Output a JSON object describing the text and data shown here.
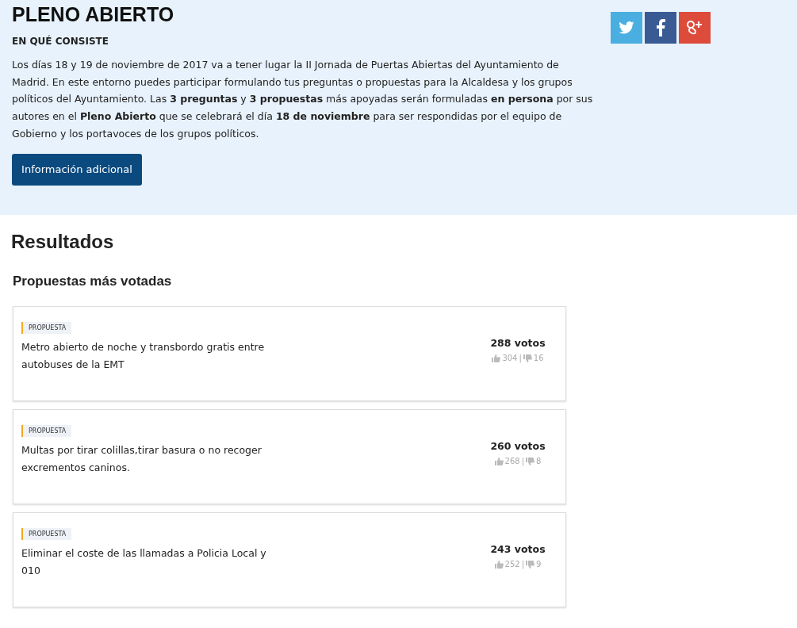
{
  "header": {
    "title": "PLENO ABIERTO",
    "subtitle": "EN QUÉ CONSISTE",
    "description": "Los días 18 y 19 de noviembre de 2017 va a tener lugar la II Jornada de Puertas Abiertas del Ayuntamiento de Madrid. En este entorno puedes participar formulando tus preguntas o propuestas para la Alcaldesa y los grupos políticos del Ayuntamiento. Las **3 preguntas** y **3 propuestas** más apoyadas serán formuladas **en persona** por sus autores en el **Pleno Abierto** que se celebrará el día **18 de noviembre** para ser respondidas por el equipo de Gobierno y los portavoces de los grupos políticos.",
    "button": "Información adicional",
    "social": [
      {
        "kind": "twitter",
        "color": "#4aafe0"
      },
      {
        "kind": "facebook",
        "color": "#3a5a94"
      },
      {
        "kind": "googleplus",
        "color": "#dd4b3b"
      }
    ]
  },
  "results": {
    "title": "Resultados",
    "section": "Propuestas más votadas",
    "proposals": [
      {
        "tag": "PROPUESTA",
        "title": "Metro abierto de noche y transbordo gratis entre autobuses de la EMT",
        "votes": "288 votos",
        "likes": "304",
        "separator": "|",
        "dislikes": "16"
      },
      {
        "tag": "PROPUESTA",
        "title": "Multas por tirar colillas,tirar basura o no recoger excrementos caninos.",
        "votes": "260 votos",
        "likes": "268",
        "separator": "|",
        "dislikes": "8"
      },
      {
        "tag": "PROPUESTA",
        "title": "Eliminar el coste de las llamadas a Policia Local y 010",
        "votes": "243 votos",
        "likes": "252",
        "separator": "|",
        "dislikes": "9"
      }
    ]
  }
}
